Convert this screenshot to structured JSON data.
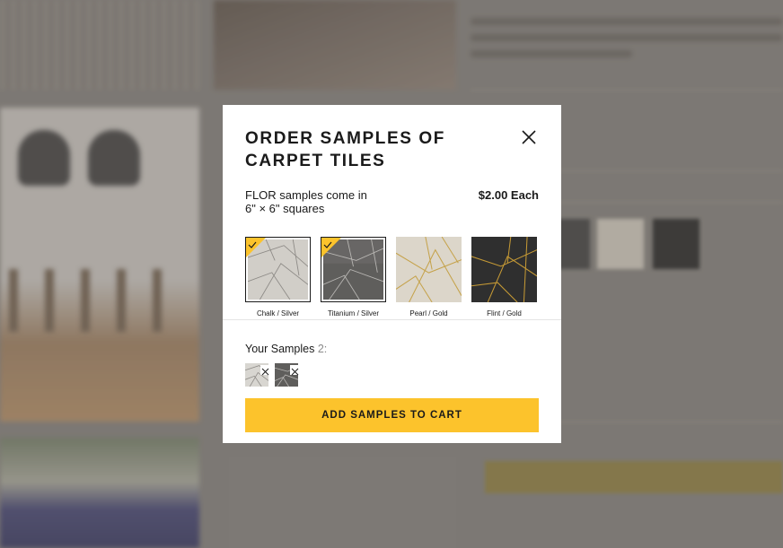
{
  "modal": {
    "title": "ORDER SAMPLES OF CARPET TILES",
    "info_text": "FLOR samples come in 6\" × 6\" squares",
    "price": "$2.00 Each",
    "close_icon": "close-icon"
  },
  "swatches": [
    {
      "label": "Chalk / Silver",
      "selected": true,
      "base": "#d8d6d1",
      "line": "#8d8a86"
    },
    {
      "label": "Titanium / Silver",
      "selected": true,
      "base": "#5f5e5c",
      "line": "#b9b7b4"
    },
    {
      "label": "Pearl / Gold",
      "selected": false,
      "base": "#dcd6ca",
      "line": "#c5a24a"
    },
    {
      "label": "Flint / Gold",
      "selected": false,
      "base": "#2f2f2f",
      "line": "#c69a35"
    }
  ],
  "samples": {
    "label": "Your Samples",
    "count": "2:",
    "chips": [
      {
        "swatch": "Chalk / Silver",
        "remove_icon": "remove-icon"
      },
      {
        "swatch": "Titanium / Silver",
        "remove_icon": "remove-icon"
      }
    ]
  },
  "cta": {
    "label": "ADD SAMPLES TO CART"
  },
  "colors": {
    "accent": "#fcc32c",
    "check_badge": "#fcc32c",
    "text": "#1a1a1a",
    "muted": "#8a8a8a"
  }
}
